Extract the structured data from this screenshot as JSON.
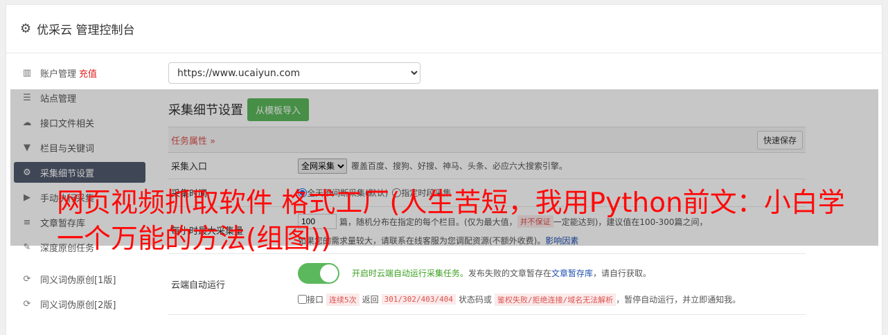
{
  "header": {
    "title": "优采云 管理控制台"
  },
  "sidebar": {
    "items": [
      {
        "label": "账户管理",
        "extra": "充值",
        "icon": "bar-chart-icon"
      },
      {
        "label": "站点管理",
        "icon": "server-icon"
      },
      {
        "label": "接口文件相关",
        "icon": "cloud-upload-icon"
      },
      {
        "label": "栏目与关键词",
        "icon": "filter-icon"
      },
      {
        "label": "采集细节设置",
        "icon": "gears-icon",
        "active": true
      },
      {
        "label": "手动执行采集",
        "icon": "play-icon"
      },
      {
        "label": "文章暂存库",
        "icon": "database-icon"
      },
      {
        "label": "深度原创任务",
        "icon": "edit-icon"
      },
      {
        "label": "同义词伪原创[1版]",
        "icon": "refresh-icon"
      },
      {
        "label": "同义词伪原创[2版]",
        "icon": "refresh-icon"
      }
    ]
  },
  "main": {
    "site_select": "https://www.ucaiyun.com",
    "section_title": "采集细节设置",
    "import_button": "从模板导入",
    "task_attr": "任务属性",
    "quick_save": "快速保存",
    "rows": {
      "collect_entry": {
        "label": "采集入口",
        "select": "全网采集",
        "desc": "覆盖百度、搜狗、好搜、神马、头条、必应六大搜索引擎。"
      },
      "collect_time": {
        "label": "采集时间",
        "opt1": "全天不间断采集(默认)",
        "opt2": "指定时段采集"
      },
      "hourly": {
        "label": "每小时最大采集量",
        "value": "100",
        "desc_a": "篇，随机分布在指定的每个栏目。(仅为最大值，",
        "tag": "并不保证",
        "desc_b": "一定能达到)，建议值在100-300篇之间，",
        "line2": "如果您的需求量较大，请联系在线客服为您调配资源(不额外收费)。",
        "link": "影响因素"
      },
      "cloud_run": {
        "label": "云端自动运行",
        "status": "开启时云端自动运行采集任务。",
        "desc": "发布失败的文章暂存在",
        "link": "文章暂存库",
        "desc_end": "，请自行获取。",
        "chk_label": "接口",
        "tag1": "连续5次",
        "t1": "返回",
        "tag2": "301/302/403/404",
        "t2": "状态码或",
        "tag3": "鉴权失败/拒绝连接/域名无法解析",
        "t3": "，暂停自动运行，并立即通知我。"
      }
    }
  },
  "overlay_headline": "网页视频抓取软件 格式工厂(人生苦短，我用Python前文：小白学一个万能的方法(组图))"
}
